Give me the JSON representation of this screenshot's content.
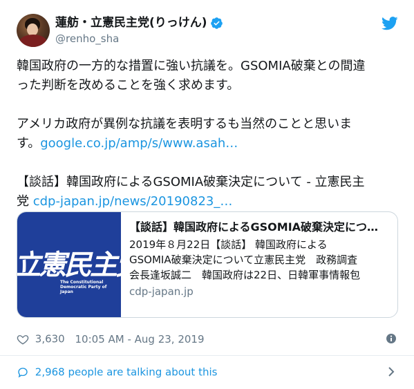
{
  "user": {
    "display_name": "蓮舫・立憲民主党(りっけん)",
    "handle": "@renho_sha",
    "verified": true,
    "avatar_icon": "profile-photo"
  },
  "tweet": {
    "line1": "韓国政府の一方的な措置に強い抗議を。GSOMIA破棄との間違",
    "line2": "った判断を改めることを強く求めます。",
    "line3": "アメリカ政府が異例な抗議を表明するも当然のことと思いま",
    "line4_prefix": "す。",
    "link1": "google.co.jp/amp/s/www.asah…",
    "line5": "【談話】韓国政府によるGSOMIA破棄決定について - 立憲民主",
    "line6_prefix": "党 ",
    "link2": "cdp-japan.jp/news/20190823_…"
  },
  "card": {
    "logo_text": "立憲民主党",
    "logo_subtext_1": "The Constitutional",
    "logo_subtext_2": "Democratic Party of Japan",
    "title": "【談話】韓国政府によるGSOMIA破棄決定につ…",
    "description_1": "2019年８月22日【談話】 韓国政府による",
    "description_2": "GSOMIA破棄決定について立憲民主党　政務調査",
    "description_3": "会長逢坂誠二　韓国政府は22日、日韓軍事情報包",
    "domain": "cdp-japan.jp"
  },
  "meta": {
    "likes": "3,630",
    "timestamp": "10:05 AM - Aug 23, 2019"
  },
  "footer": {
    "talking": "2,968 people are talking about this"
  },
  "colors": {
    "link": "#1b95e0",
    "twitter_blue": "#1da1f2",
    "secondary_text": "#657786",
    "card_image_bg": "#1f3f9a"
  }
}
